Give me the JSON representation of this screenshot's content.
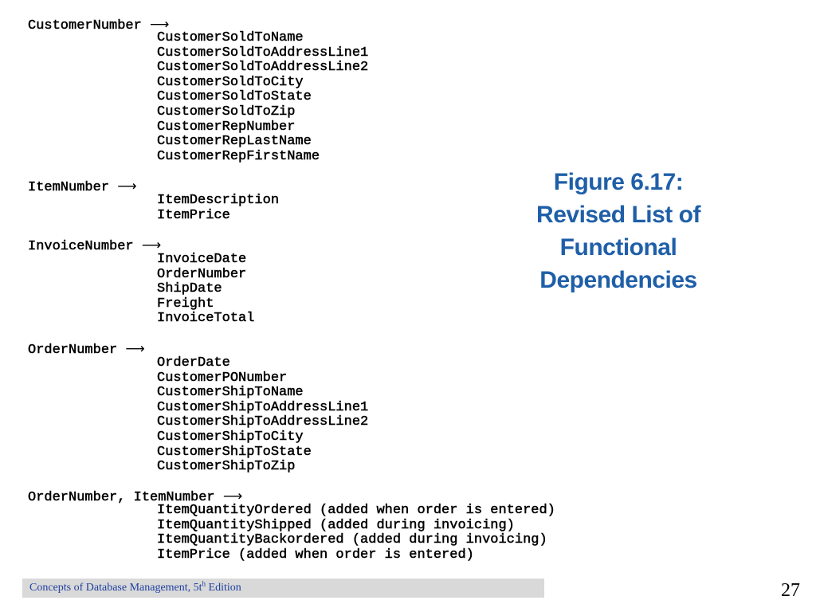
{
  "dependencies": [
    {
      "determinant": "CustomerNumber",
      "dependents": [
        "CustomerSoldToName",
        "CustomerSoldToAddressLine1",
        "CustomerSoldToAddressLine2",
        "CustomerSoldToCity",
        "CustomerSoldToState",
        "CustomerSoldToZip",
        "CustomerRepNumber",
        "CustomerRepLastName",
        "CustomerRepFirstName"
      ]
    },
    {
      "determinant": "ItemNumber",
      "dependents": [
        "ItemDescription",
        "ItemPrice"
      ]
    },
    {
      "determinant": "InvoiceNumber",
      "dependents": [
        "InvoiceDate",
        "OrderNumber",
        "ShipDate",
        "Freight",
        "InvoiceTotal"
      ]
    },
    {
      "determinant": "OrderNumber",
      "dependents": [
        "OrderDate",
        "CustomerPONumber",
        "CustomerShipToName",
        "CustomerShipToAddressLine1",
        "CustomerShipToAddressLine2",
        "CustomerShipToCity",
        "CustomerShipToState",
        "CustomerShipToZip"
      ]
    },
    {
      "determinant": "OrderNumber, ItemNumber",
      "dependents": [
        "ItemQuantityOrdered (added when order is entered)",
        "ItemQuantityShipped (added during invoicing)",
        "ItemQuantityBackordered (added during invoicing)",
        "ItemPrice (added when order is entered)"
      ]
    }
  ],
  "figure": {
    "line1": "Figure 6.17:",
    "line2": "Revised List of",
    "line3": "Functional",
    "line4": "Dependencies"
  },
  "footer": {
    "text_before": "Concepts of Database Management, 5t",
    "superscript": "h",
    "text_after": " Edition",
    "page_number": "27"
  },
  "colors": {
    "title": "#1F5FA8",
    "footer_text": "#1F3FA0",
    "footer_bar": "#D9D9D9"
  }
}
